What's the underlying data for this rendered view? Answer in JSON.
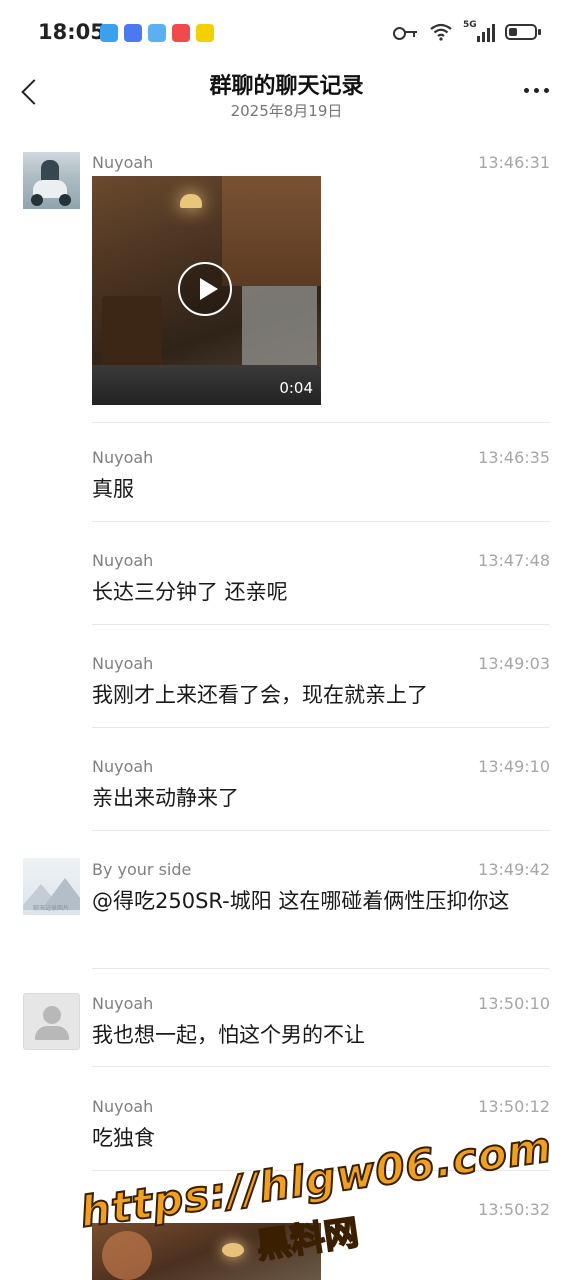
{
  "status_bar": {
    "time": "18:05",
    "network": "5G",
    "app_icons": [
      {
        "name": "reader-app-icon",
        "color": "#3aa0f0"
      },
      {
        "name": "notes-app-icon",
        "color": "#4a79f0"
      },
      {
        "name": "weather-app-icon",
        "color": "#5ab0f0"
      },
      {
        "name": "video-app-icon",
        "color": "#f04a4a"
      },
      {
        "name": "meituan-app-icon",
        "color": "#f5d000"
      }
    ],
    "battery_level": 0.35
  },
  "header": {
    "title": "群聊的聊天记录",
    "date": "2025年8月19日"
  },
  "messages": [
    {
      "sender": "Nuyoah",
      "time": "13:46:31",
      "type": "video",
      "duration": "0:04",
      "avatar": "motorcycle-photo"
    },
    {
      "sender": "Nuyoah",
      "time": "13:46:35",
      "type": "text",
      "text": "真服"
    },
    {
      "sender": "Nuyoah",
      "time": "13:47:48",
      "type": "text",
      "text": "长达三分钟了 还亲呢"
    },
    {
      "sender": "Nuyoah",
      "time": "13:49:03",
      "type": "text",
      "text": "我刚才上来还看了会，现在就亲上了"
    },
    {
      "sender": "Nuyoah",
      "time": "13:49:10",
      "type": "text",
      "text": "亲出来动静来了"
    },
    {
      "sender": "By your side",
      "time": "13:49:42",
      "type": "text",
      "text": "@得吃250SR-城阳 这在哪碰着俩性压抑你这",
      "avatar": "landscape-image",
      "avatar_caption": "聊天记录图片"
    },
    {
      "sender": "Nuyoah",
      "time": "13:50:10",
      "type": "text",
      "text": "我也想一起，怕这个男的不让",
      "avatar": "default-person"
    },
    {
      "sender": "Nuyoah",
      "time": "13:50:12",
      "type": "text",
      "text": "吃独食"
    },
    {
      "sender": "",
      "time": "13:50:32",
      "type": "video"
    }
  ],
  "watermark": {
    "url": "https://hlgw06.com",
    "site": "黑料网"
  }
}
